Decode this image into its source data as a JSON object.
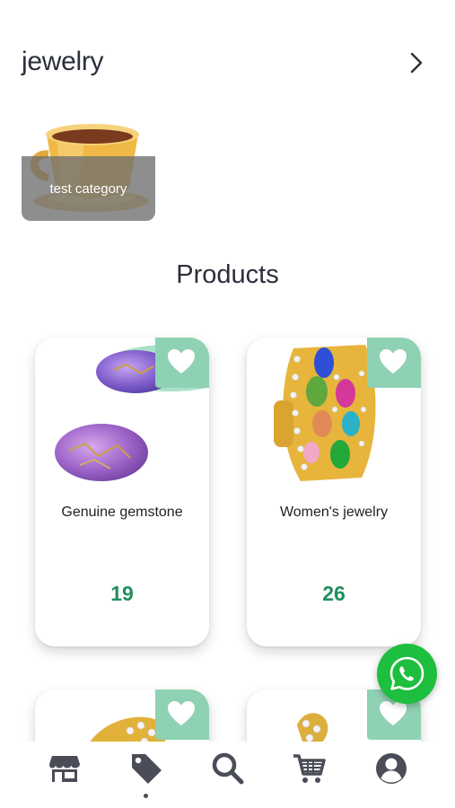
{
  "header": {
    "title": "jewelry",
    "more_icon": "chevron-right-icon"
  },
  "category": {
    "label": "test category",
    "image": "coffee-cup"
  },
  "section": {
    "title": "Products"
  },
  "products": [
    {
      "name": "Genuine gemstone",
      "price": "19",
      "image": "purple-gemstones"
    },
    {
      "name": "Women's jewelry",
      "price": "26",
      "image": "gem-ring"
    }
  ],
  "colors": {
    "accent": "#8fd1b3",
    "price": "#1f8f5f",
    "whatsapp": "#1ebe3e",
    "nav_icon": "#4a4d57"
  },
  "nav": {
    "items": [
      "store-icon",
      "tag-icon",
      "search-icon",
      "cart-icon",
      "profile-icon"
    ],
    "active": "tag-icon"
  }
}
